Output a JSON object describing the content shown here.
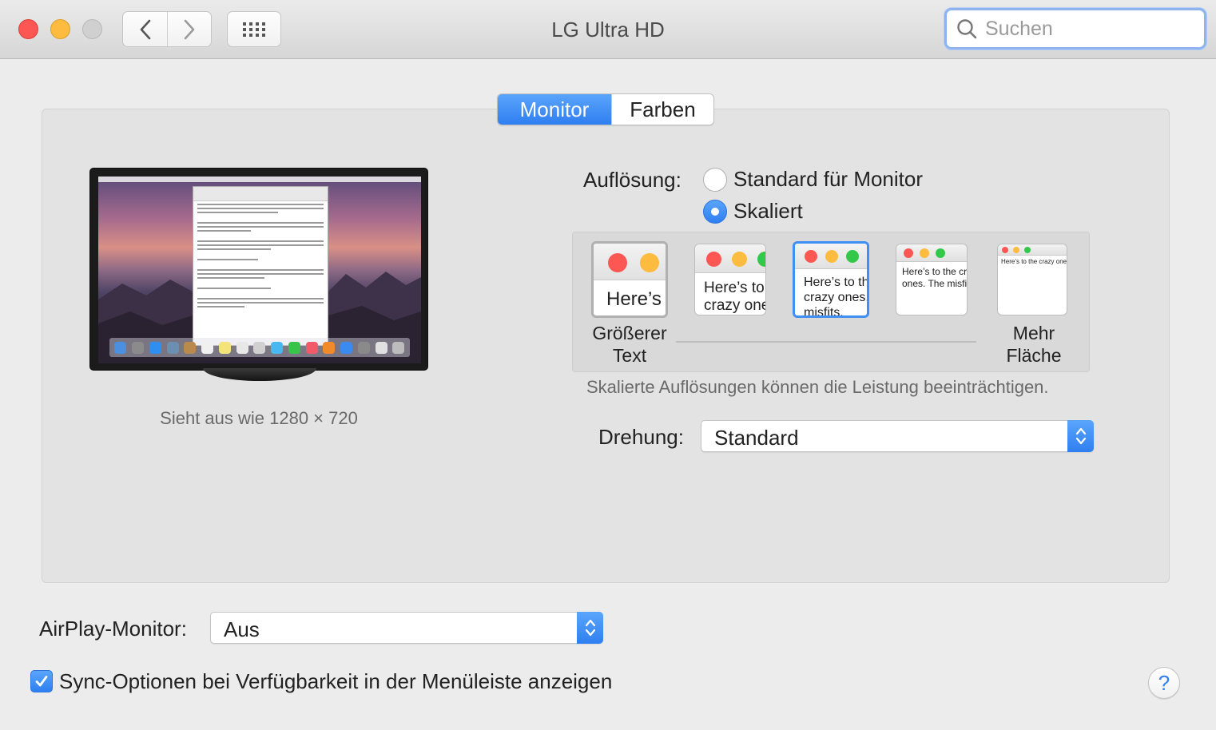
{
  "window": {
    "title": "LG Ultra HD",
    "search_placeholder": "Suchen"
  },
  "icons": {
    "back": "chevron-left-icon",
    "forward": "chevron-right-icon",
    "grid": "grid-icon",
    "search": "magnifier-icon"
  },
  "tabs": [
    {
      "label": "Monitor",
      "selected": true
    },
    {
      "label": "Farben",
      "selected": false
    }
  ],
  "preview": {
    "looks_like": "Sieht aus wie 1280 × 720"
  },
  "resolution": {
    "label": "Auflösung:",
    "options": [
      {
        "label": "Standard für Monitor",
        "selected": false
      },
      {
        "label": "Skaliert",
        "selected": true
      }
    ],
    "scale_thumbs": [
      {
        "text": "Here’s",
        "selected": false
      },
      {
        "text": "Here’s to the crazy ones. The misfits.",
        "selected": false
      },
      {
        "text": "Here’s to the crazy ones. The misfits.",
        "selected": true
      },
      {
        "text": "Here’s to the crazy ones. The misfits.",
        "selected": false
      },
      {
        "text": "Here’s to the crazy ones.",
        "selected": false
      }
    ],
    "larger_text_label_1": "Größerer",
    "larger_text_label_2": "Text",
    "more_space_label_1": "Mehr",
    "more_space_label_2": "Fläche",
    "note": "Skalierte Auflösungen können die Leistung beeinträchtigen."
  },
  "rotation": {
    "label": "Drehung:",
    "value": "Standard"
  },
  "airplay": {
    "label": "AirPlay-Monitor:",
    "value": "Aus"
  },
  "sync_option": {
    "label": "Sync-Optionen bei Verfügbarkeit in der Menüleiste anzeigen",
    "checked": true
  },
  "help_label": "?",
  "colors": {
    "accent": "#2f7ff1",
    "close": "#fc5753",
    "minimize": "#fdbc40"
  }
}
